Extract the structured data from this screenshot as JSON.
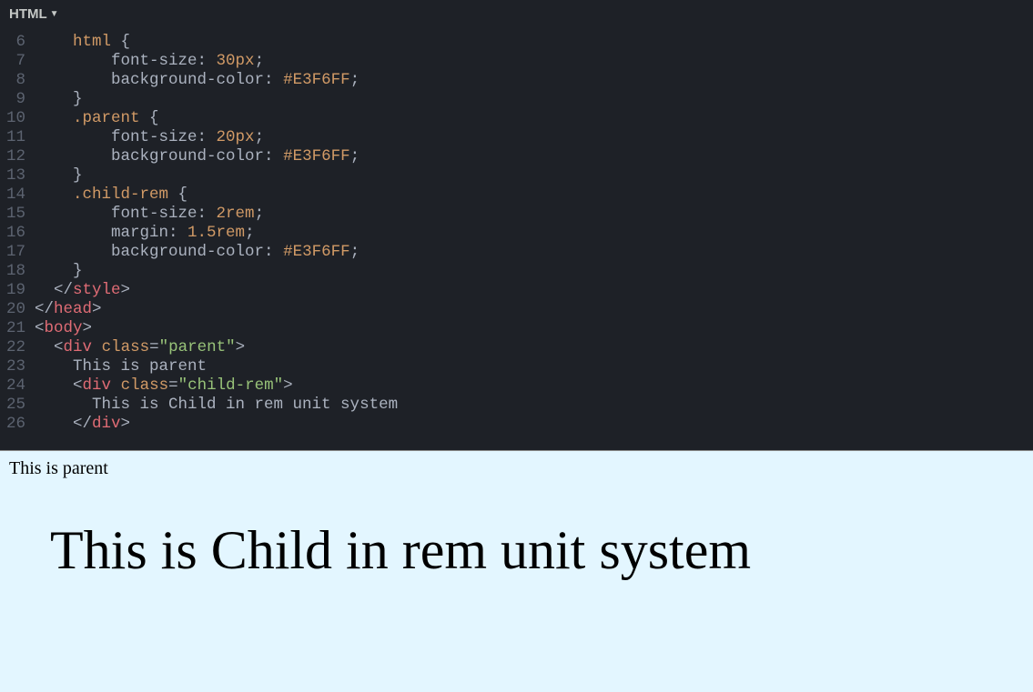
{
  "tab": {
    "label": "HTML"
  },
  "lines": {
    "l5": {
      "num": "",
      "tokens": []
    },
    "l6": {
      "num": "6",
      "indent": "    ",
      "tokens": [
        [
          "selector",
          "html"
        ],
        [
          "brace",
          " {"
        ]
      ]
    },
    "l7": {
      "num": "7",
      "indent": "        ",
      "tokens": [
        [
          "prop",
          "font-size"
        ],
        [
          "punct",
          ": "
        ],
        [
          "num",
          "30px"
        ],
        [
          "punct",
          ";"
        ]
      ]
    },
    "l8": {
      "num": "8",
      "indent": "        ",
      "tokens": [
        [
          "prop",
          "background-color"
        ],
        [
          "punct",
          ": "
        ],
        [
          "num",
          "#E3F6FF"
        ],
        [
          "punct",
          ";"
        ]
      ]
    },
    "l9": {
      "num": "9",
      "indent": "    ",
      "tokens": [
        [
          "brace",
          "}"
        ]
      ]
    },
    "l10": {
      "num": "10",
      "indent": "    ",
      "tokens": [
        [
          "selector",
          ".parent"
        ],
        [
          "brace",
          " {"
        ]
      ]
    },
    "l11": {
      "num": "11",
      "indent": "        ",
      "tokens": [
        [
          "prop",
          "font-size"
        ],
        [
          "punct",
          ": "
        ],
        [
          "num",
          "20px"
        ],
        [
          "punct",
          ";"
        ]
      ]
    },
    "l12": {
      "num": "12",
      "indent": "        ",
      "tokens": [
        [
          "prop",
          "background-color"
        ],
        [
          "punct",
          ": "
        ],
        [
          "num",
          "#E3F6FF"
        ],
        [
          "punct",
          ";"
        ]
      ]
    },
    "l13": {
      "num": "13",
      "indent": "    ",
      "tokens": [
        [
          "brace",
          "}"
        ]
      ]
    },
    "l14": {
      "num": "14",
      "indent": "    ",
      "tokens": [
        [
          "selector",
          ".child-rem"
        ],
        [
          "brace",
          " {"
        ]
      ]
    },
    "l15": {
      "num": "15",
      "indent": "        ",
      "tokens": [
        [
          "prop",
          "font-size"
        ],
        [
          "punct",
          ": "
        ],
        [
          "num",
          "2rem"
        ],
        [
          "punct",
          ";"
        ]
      ]
    },
    "l16": {
      "num": "16",
      "indent": "        ",
      "tokens": [
        [
          "prop",
          "margin"
        ],
        [
          "punct",
          ": "
        ],
        [
          "num",
          "1.5rem"
        ],
        [
          "punct",
          ";"
        ]
      ]
    },
    "l17": {
      "num": "17",
      "indent": "        ",
      "tokens": [
        [
          "prop",
          "background-color"
        ],
        [
          "punct",
          ": "
        ],
        [
          "num",
          "#E3F6FF"
        ],
        [
          "punct",
          ";"
        ]
      ]
    },
    "l18": {
      "num": "18",
      "indent": "    ",
      "tokens": [
        [
          "brace",
          "}"
        ]
      ]
    },
    "l19": {
      "num": "19",
      "indent": "  ",
      "tokens": [
        [
          "punct",
          "</"
        ],
        [
          "tag",
          "style"
        ],
        [
          "punct",
          ">"
        ]
      ]
    },
    "l20": {
      "num": "20",
      "indent": "",
      "tokens": [
        [
          "punct",
          "</"
        ],
        [
          "tag",
          "head"
        ],
        [
          "punct",
          ">"
        ]
      ]
    },
    "l21": {
      "num": "21",
      "indent": "",
      "tokens": [
        [
          "punct",
          "<"
        ],
        [
          "tag",
          "body"
        ],
        [
          "punct",
          ">"
        ]
      ]
    },
    "l22": {
      "num": "22",
      "indent": "  ",
      "tokens": [
        [
          "punct",
          "<"
        ],
        [
          "tag",
          "div"
        ],
        [
          "punct",
          " "
        ],
        [
          "attr",
          "class"
        ],
        [
          "punct",
          "="
        ],
        [
          "str",
          "\"parent\""
        ],
        [
          "punct",
          ">"
        ]
      ]
    },
    "l23": {
      "num": "23",
      "indent": "    ",
      "tokens": [
        [
          "prop",
          "This is parent"
        ]
      ]
    },
    "l24": {
      "num": "24",
      "indent": "    ",
      "tokens": [
        [
          "punct",
          "<"
        ],
        [
          "tag",
          "div"
        ],
        [
          "punct",
          " "
        ],
        [
          "attr",
          "class"
        ],
        [
          "punct",
          "="
        ],
        [
          "str",
          "\"child-rem\""
        ],
        [
          "punct",
          ">"
        ]
      ]
    },
    "l25": {
      "num": "25",
      "indent": "      ",
      "tokens": [
        [
          "prop",
          "This is Child in rem unit system"
        ]
      ]
    },
    "l26": {
      "num": "26",
      "indent": "    ",
      "tokens": [
        [
          "punct",
          "</"
        ],
        [
          "tag",
          "div"
        ],
        [
          "punct",
          ">"
        ]
      ]
    }
  },
  "lineOrder": [
    "l5",
    "l6",
    "l7",
    "l8",
    "l9",
    "l10",
    "l11",
    "l12",
    "l13",
    "l14",
    "l15",
    "l16",
    "l17",
    "l18",
    "l19",
    "l20",
    "l21",
    "l22",
    "l23",
    "l24",
    "l25",
    "l26"
  ],
  "preview": {
    "parentText": "This is parent",
    "childText": "This is Child in rem unit system"
  }
}
